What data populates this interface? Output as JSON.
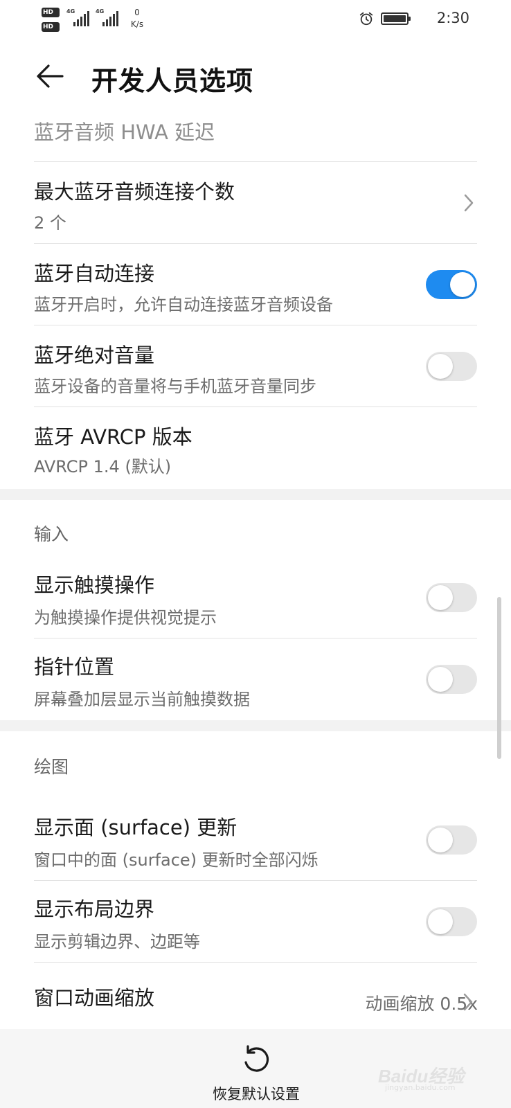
{
  "status_bar": {
    "sim1": "HD",
    "sim2": "HD",
    "network1": "4G",
    "network2": "4G",
    "speed_value": "0",
    "speed_unit": "K/s",
    "time": "2:30",
    "alarm_icon": "alarm-clock-icon",
    "battery_icon": "battery-full-icon"
  },
  "app_bar": {
    "back_icon": "back-arrow-icon",
    "title": "开发人员选项"
  },
  "items": {
    "hwa_delay": {
      "title": "蓝牙音频 HWA 延迟"
    },
    "max_connections": {
      "title": "最大蓝牙音频连接个数",
      "value": "2 个",
      "icon": "chevron-right-icon"
    },
    "auto_connect": {
      "title": "蓝牙自动连接",
      "subtitle": "蓝牙开启时，允许自动连接蓝牙音频设备",
      "enabled": true
    },
    "absolute_volume": {
      "title": "蓝牙绝对音量",
      "subtitle": "蓝牙设备的音量将与手机蓝牙音量同步",
      "enabled": false
    },
    "avrcp_version": {
      "title": "蓝牙 AVRCP 版本",
      "value": "AVRCP 1.4 (默认)"
    }
  },
  "input_section": {
    "header": "输入",
    "show_touches": {
      "title": "显示触摸操作",
      "subtitle": "为触摸操作提供视觉提示",
      "enabled": false
    },
    "pointer_location": {
      "title": "指针位置",
      "subtitle": "屏幕叠加层显示当前触摸数据",
      "enabled": false
    }
  },
  "drawing_section": {
    "header": "绘图",
    "surface_updates": {
      "title": "显示面 (surface) 更新",
      "subtitle": "窗口中的面 (surface) 更新时全部闪烁",
      "enabled": false
    },
    "layout_bounds": {
      "title": "显示布局边界",
      "subtitle": "显示剪辑边界、边距等",
      "enabled": false
    },
    "window_animation": {
      "title": "窗口动画缩放",
      "value": "动画缩放 0.5x",
      "icon": "chevron-right-icon"
    }
  },
  "bottom_bar": {
    "reset_label": "恢复默认设置",
    "reset_icon": "restore-icon"
  },
  "watermark": {
    "text": "Baidu经验",
    "url": "jingyan.baidu.com"
  },
  "colors": {
    "accent": "#1e8bf0",
    "toggle_off": "#e6e6e6",
    "divider": "#e2e2e2",
    "section_gap": "#f2f2f2"
  }
}
